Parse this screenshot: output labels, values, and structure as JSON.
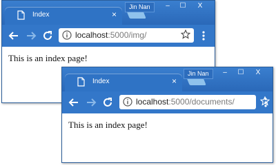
{
  "windows": [
    {
      "user_name": "Jin Nan",
      "tab_title": "Index",
      "tab_close": "×",
      "controls": {
        "minimize": "–",
        "maximize": "☐",
        "close": "X"
      },
      "url_host": "localhost",
      "url_path": ":5000/img/",
      "page_text": "This is an index page!"
    },
    {
      "user_name": "Jin Nan",
      "tab_title": "Index",
      "tab_close": "×",
      "controls": {
        "minimize": "–",
        "maximize": "☐",
        "close": "X"
      },
      "url_host": "localhost",
      "url_path": ":5000/documents/",
      "page_text": "This is an index page!"
    }
  ],
  "theme": {
    "titlebar": "#2a68b8",
    "toolbar": "#3377c9",
    "new_tab": "#8fc2ec"
  },
  "icons": [
    "page-icon",
    "back-arrow-icon",
    "forward-arrow-icon",
    "reload-icon",
    "info-icon",
    "star-icon",
    "menu-dots-icon"
  ]
}
